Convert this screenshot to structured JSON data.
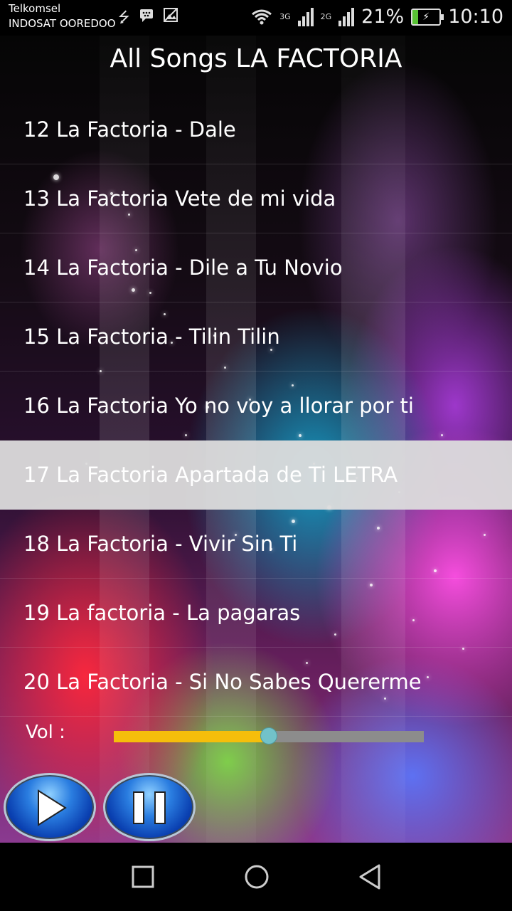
{
  "status_bar": {
    "carrier_1": "Telkomsel",
    "carrier_2": "INDOSAT OOREDOO",
    "network_1": "3G",
    "network_2": "2G",
    "battery_percent": "21%",
    "time": "10:10",
    "icons": [
      "usb-icon",
      "messenger-icon",
      "image-icon",
      "wifi-icon",
      "signal-icon",
      "battery-charging-icon"
    ]
  },
  "app": {
    "title": "All Songs LA FACTORIA",
    "songs": [
      "12 La Factoria - Dale",
      "13 La Factoria Vete de mi vida",
      "14 La Factoria - Dile a Tu Novio",
      "15 La Factoria - Tilin Tilin",
      "16 La Factoria Yo no voy a llorar por ti",
      "17 La Factoria Apartada de Ti LETRA",
      "18 La Factoria - Vivir Sin Ti",
      "19 La factoria - La pagaras",
      "20 La Factoria - Si No Sabes Quererme"
    ],
    "selected_index": 5,
    "volume": {
      "label": "Vol :",
      "level": 0.5
    },
    "controls": [
      "play-icon",
      "pause-icon"
    ]
  },
  "nav_bar": {
    "icons": [
      "recents-icon",
      "home-icon",
      "back-icon"
    ]
  },
  "colors": {
    "slider_fill": "#f5be0b",
    "slider_track": "#8c8c8c",
    "slider_thumb": "#72c2c9",
    "selected_row": "#dcdcdc"
  }
}
